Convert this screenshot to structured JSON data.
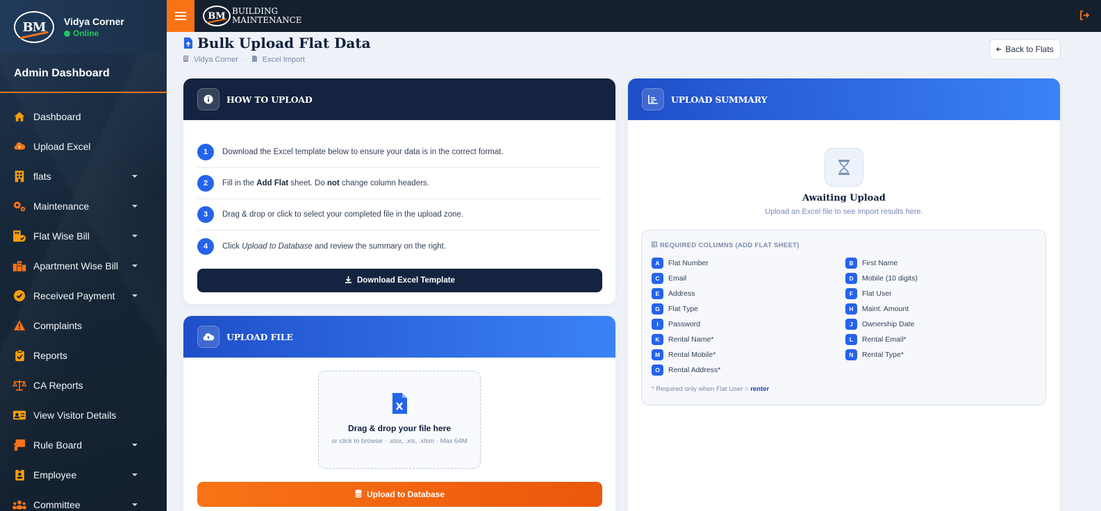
{
  "sidebar": {
    "logo_text": "BM",
    "user_name": "Vidya Corner",
    "user_status": "Online",
    "section_title": "Admin Dashboard",
    "items": [
      {
        "label": "Dashboard",
        "icon": "home-icon"
      },
      {
        "label": "Upload Excel",
        "icon": "cloud-upload-icon"
      },
      {
        "label": "flats",
        "icon": "building-icon"
      },
      {
        "label": "Maintenance",
        "icon": "gears-icon"
      },
      {
        "label": "Flat Wise Bill",
        "icon": "building-check-icon"
      },
      {
        "label": "Apartment Wise Bill",
        "icon": "city-icon"
      },
      {
        "label": "Received Payment",
        "icon": "check-circle-icon"
      },
      {
        "label": "Complaints",
        "icon": "warning-icon"
      },
      {
        "label": "Reports",
        "icon": "clipboard-check-icon"
      },
      {
        "label": "CA Reports",
        "icon": "scale-icon"
      },
      {
        "label": "View Visitor Details",
        "icon": "id-card-icon"
      },
      {
        "label": "Rule Board",
        "icon": "board-icon"
      },
      {
        "label": "Employee",
        "icon": "id-badge-icon"
      },
      {
        "label": "Committee",
        "icon": "users-icon"
      }
    ]
  },
  "topbar": {
    "brand_logo": "BM",
    "brand_line1": "BUILDING",
    "brand_line2": "MAINTENANCE"
  },
  "page": {
    "title": "Bulk Upload Flat Data",
    "breadcrumb_1": "Vidya Corner",
    "breadcrumb_2": "Excel Import",
    "back_button": "Back to Flats"
  },
  "how_to": {
    "title": "HOW TO UPLOAD",
    "steps": [
      {
        "num": "1",
        "pre": "Download the Excel template below to ensure your data is in the correct format.",
        "b1": "",
        "mid": "",
        "b2": "",
        "post": ""
      },
      {
        "num": "2",
        "pre": "Fill in the ",
        "b1": "Add Flat",
        "mid": " sheet. Do ",
        "b2": "not",
        "post": " change column headers."
      },
      {
        "num": "3",
        "pre": "Drag & drop or click to select your completed file in the upload zone.",
        "b1": "",
        "mid": "",
        "b2": "",
        "post": ""
      },
      {
        "num": "4",
        "pre": "Click ",
        "em": "Upload to Database",
        "post": " and review the summary on the right."
      }
    ],
    "download_button": "Download Excel Template"
  },
  "upload": {
    "title": "UPLOAD FILE",
    "drop_title": "Drag & drop your file here",
    "drop_sub": "or click to browse · .xlsx, .xls, .xlsm · Max 64M",
    "upload_button": "Upload to Database"
  },
  "summary": {
    "title": "UPLOAD SUMMARY",
    "await_title": "Awaiting Upload",
    "await_sub": "Upload an Excel file to see import results here.",
    "req_title": "REQUIRED COLUMNS (ADD FLAT SHEET)",
    "columns": [
      {
        "letter": "A",
        "name": "Flat Number"
      },
      {
        "letter": "B",
        "name": "First Name"
      },
      {
        "letter": "C",
        "name": "Email"
      },
      {
        "letter": "D",
        "name": "Mobile (10 digits)"
      },
      {
        "letter": "E",
        "name": "Address"
      },
      {
        "letter": "F",
        "name": "Flat User"
      },
      {
        "letter": "G",
        "name": "Flat Type"
      },
      {
        "letter": "H",
        "name": "Maint. Amount"
      },
      {
        "letter": "I",
        "name": "Password"
      },
      {
        "letter": "J",
        "name": "Ownership Date"
      },
      {
        "letter": "K",
        "name": "Rental Name*"
      },
      {
        "letter": "L",
        "name": "Rental Email*"
      },
      {
        "letter": "M",
        "name": "Rental Mobile*"
      },
      {
        "letter": "N",
        "name": "Rental Type*"
      },
      {
        "letter": "O",
        "name": "Rental Address*"
      }
    ],
    "note_pre": "* Required only when Flat User = ",
    "note_value": "renter"
  },
  "colors": {
    "accent": "#f97316",
    "primary": "#2563eb",
    "dark": "#14233f",
    "online": "#22c55e"
  }
}
